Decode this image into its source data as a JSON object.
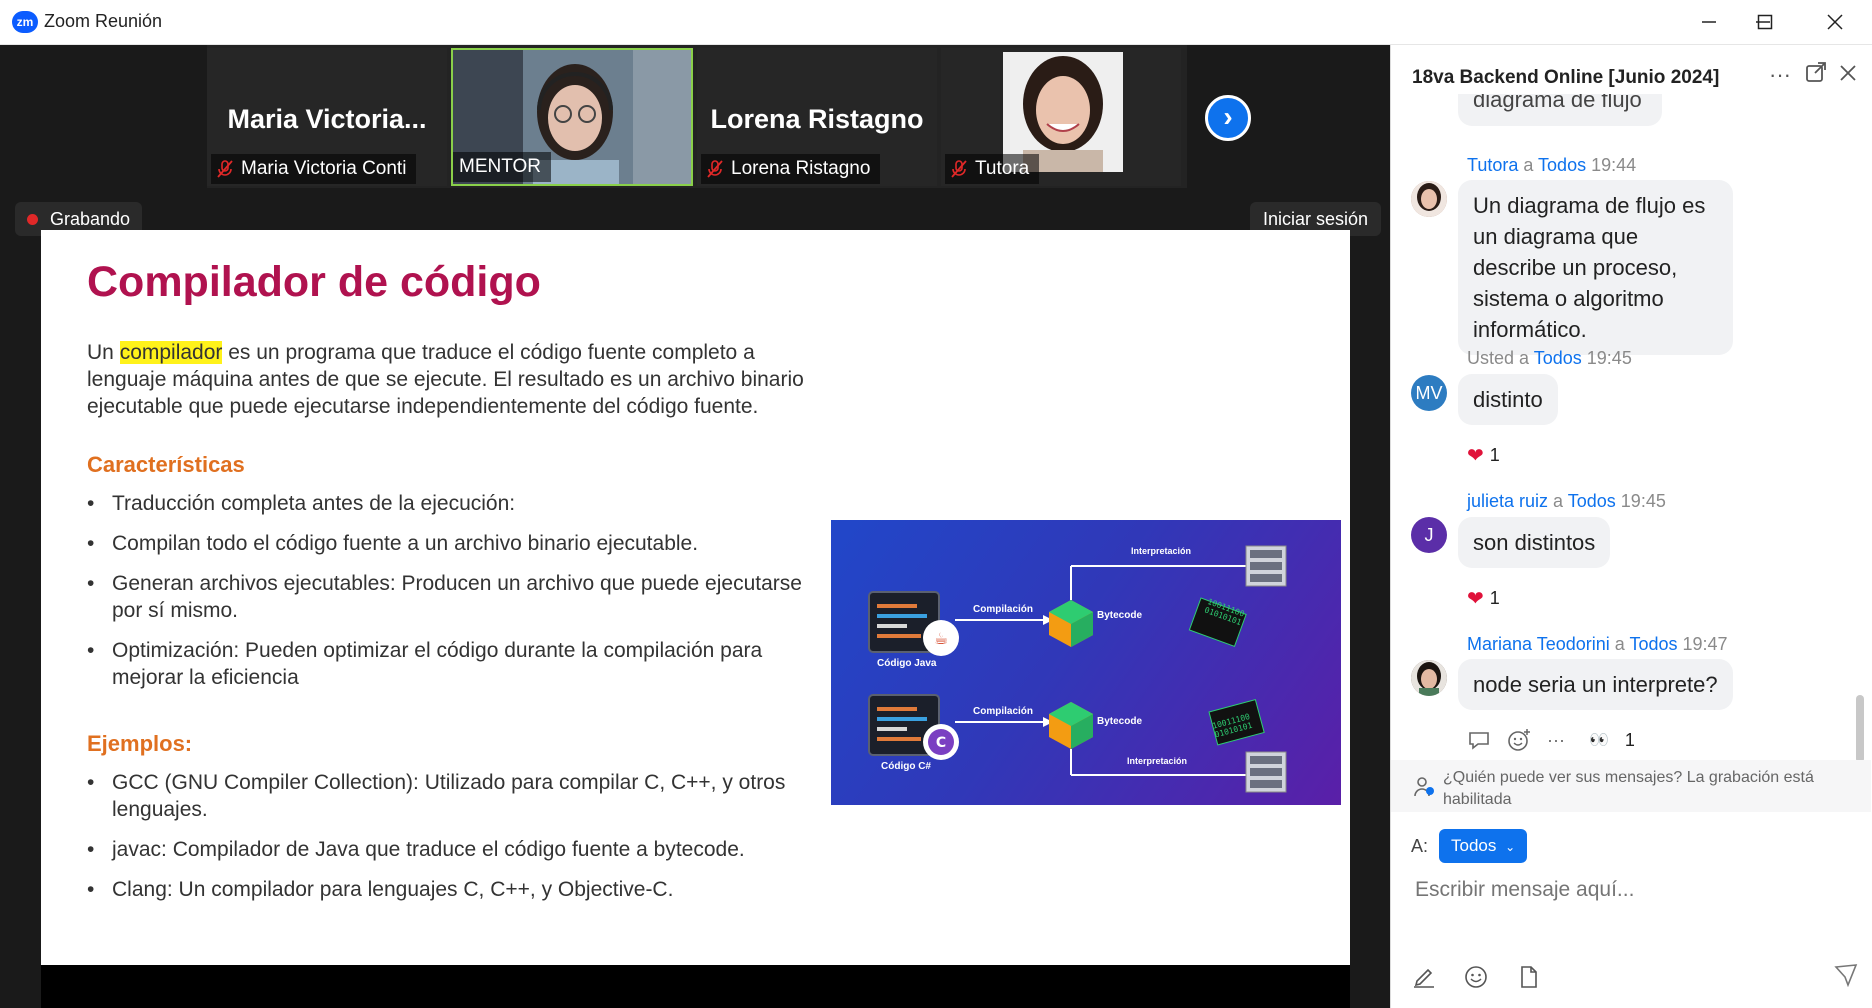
{
  "window": {
    "app_icon_text": "zm",
    "title": "Zoom Reunión"
  },
  "participants": [
    {
      "big_name": "Maria  Victoria...",
      "label": "Maria Victoria Conti",
      "muted": true
    },
    {
      "big_name": "",
      "label": "MENTOR",
      "muted": false
    },
    {
      "big_name": "Lorena Ristagno",
      "label": "Lorena Ristagno",
      "muted": true
    },
    {
      "big_name": "",
      "label": "Tutora",
      "muted": true
    }
  ],
  "meeting": {
    "recording_label": "Grabando",
    "signin_label": "Iniciar sesión"
  },
  "slide": {
    "title": "Compilador de código",
    "intro_prefix": "Un ",
    "intro_highlight": "compilador",
    "intro_rest": " es un programa que traduce el código fuente completo a lenguaje máquina antes de que se ejecute. El resultado es un archivo binario ejecutable que puede ejecutarse independientemente del código fuente.",
    "features_heading": "Características",
    "features": [
      "Traducción completa antes de la ejecución:",
      "Compilan todo el código fuente a un archivo binario ejecutable.",
      "Generan archivos ejecutables: Producen un archivo que puede ejecutarse por sí mismo.",
      "Optimización: Pueden optimizar el código durante la compilación para mejorar la eficiencia"
    ],
    "examples_heading": "Ejemplos:",
    "examples": [
      "GCC (GNU Compiler Collection): Utilizado para compilar C, C++, y otros lenguajes.",
      "javac: Compilador de Java que traduce el código fuente a bytecode.",
      "Clang: Un compilador para lenguajes C, C++, y Objective-C."
    ],
    "diagram": {
      "top": {
        "source": "Código Java",
        "step1": "Compilación",
        "mid": "Bytecode",
        "step2": "Interpretación",
        "bits": "10011100 01010101"
      },
      "bottom": {
        "source": "Código C#",
        "step1": "Compilación",
        "mid": "Bytecode",
        "step2": "Interpretación",
        "bits": "10011100 01010101"
      }
    }
  },
  "chat": {
    "title": "18va Backend Online [Junio 2024]",
    "partial_message": "diagrama de flujo",
    "messages": [
      {
        "sender": "Tutora",
        "to_word": " a ",
        "to": "Todos",
        "time": "19:44",
        "avatar": "",
        "avatar_color": "#b08878",
        "text": "Un diagrama de flujo es un diagrama que describe un proceso, sistema o algoritmo informático.",
        "reaction_count": ""
      },
      {
        "sender": "Usted",
        "to_word": " a ",
        "to": "Todos",
        "time": "19:45",
        "avatar": "MV",
        "avatar_color": "#2d7cc1",
        "text": "distinto",
        "reaction_count": "1"
      },
      {
        "sender": "julieta ruiz",
        "to_word": " a ",
        "to": "Todos",
        "time": "19:45",
        "avatar": "J",
        "avatar_color": "#5b2ea8",
        "text": "son distintos",
        "reaction_count": "1"
      },
      {
        "sender": "Mariana Teodorini",
        "to_word": " a ",
        "to": "Todos",
        "time": "19:47",
        "avatar": "",
        "avatar_color": "#6b5a52",
        "text": "node seria un interprete?",
        "reaction_count": "1"
      }
    ],
    "privacy_text": "¿Quién puede ver sus mensajes? La grabación está habilitada",
    "to_label": "A:",
    "to_button": "Todos",
    "compose_placeholder": "Escribir mensaje aquí..."
  },
  "colors": {
    "accent": "#0e72ed",
    "slide_title": "#b0124f",
    "section_heading": "#e07020",
    "highlight": "#fff21a"
  }
}
